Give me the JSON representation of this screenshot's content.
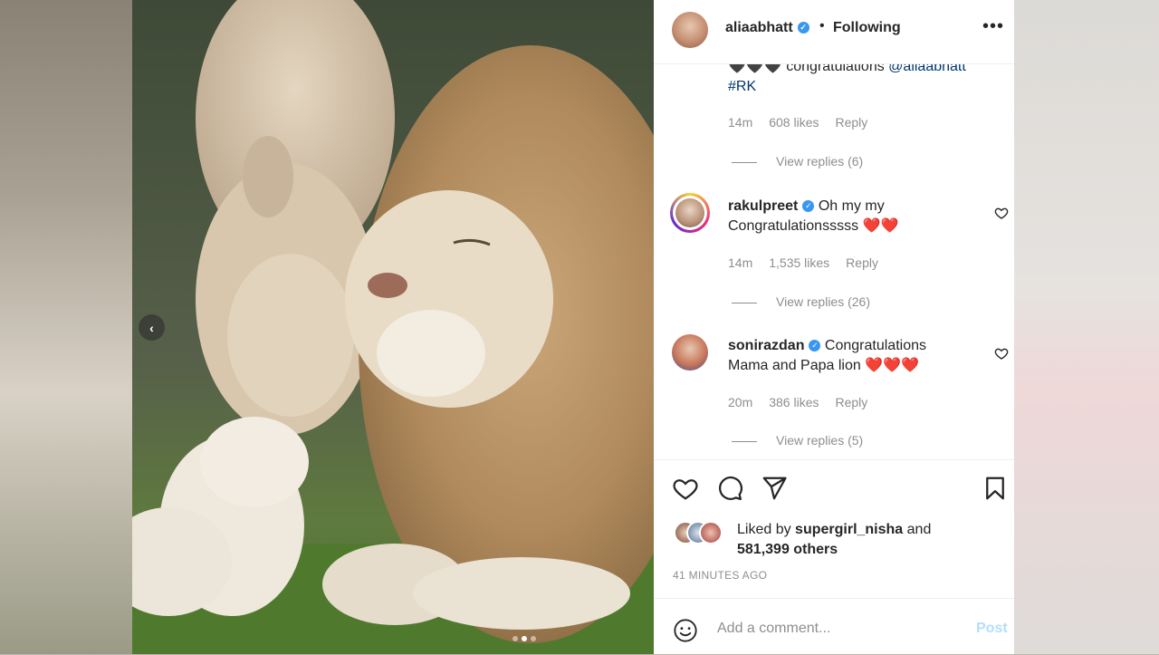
{
  "header": {
    "username": "aliaabhatt",
    "separator": "•",
    "follow_status": "Following",
    "more_icon": "ellipsis-icon",
    "more_label": "•••"
  },
  "media": {
    "prev_label": "‹"
  },
  "comments": [
    {
      "line1_prefix": "🖤🖤🖤 congratulations ",
      "mention": "@aliaabhatt",
      "line2": "#RK",
      "time": "14m",
      "likes": "608 likes",
      "reply": "Reply",
      "view_replies": "View replies (6)"
    },
    {
      "username": "rakulpreet",
      "text1": "Oh my my",
      "text2": "Congratulationsssss",
      "emoji": "❤️❤️",
      "time": "14m",
      "likes": "1,535 likes",
      "reply": "Reply",
      "view_replies": "View replies (26)"
    },
    {
      "username": "sonirazdan",
      "text1": "Congratulations",
      "text2": "Mama and Papa lion",
      "emoji": "❤️❤️❤️",
      "time": "20m",
      "likes": "386 likes",
      "reply": "Reply",
      "view_replies": "View replies (5)"
    }
  ],
  "actions": {
    "liked_prefix": "Liked by",
    "liked_user": "supergirl_nisha",
    "liked_and": "and",
    "liked_others": "581,399 others",
    "time_ago": "41 MINUTES AGO"
  },
  "add_comment": {
    "placeholder": "Add a comment...",
    "post_label": "Post"
  },
  "colors": {
    "verified": "#3897f0",
    "heart": "#e0153a",
    "post_disabled": "#b2dffc"
  }
}
